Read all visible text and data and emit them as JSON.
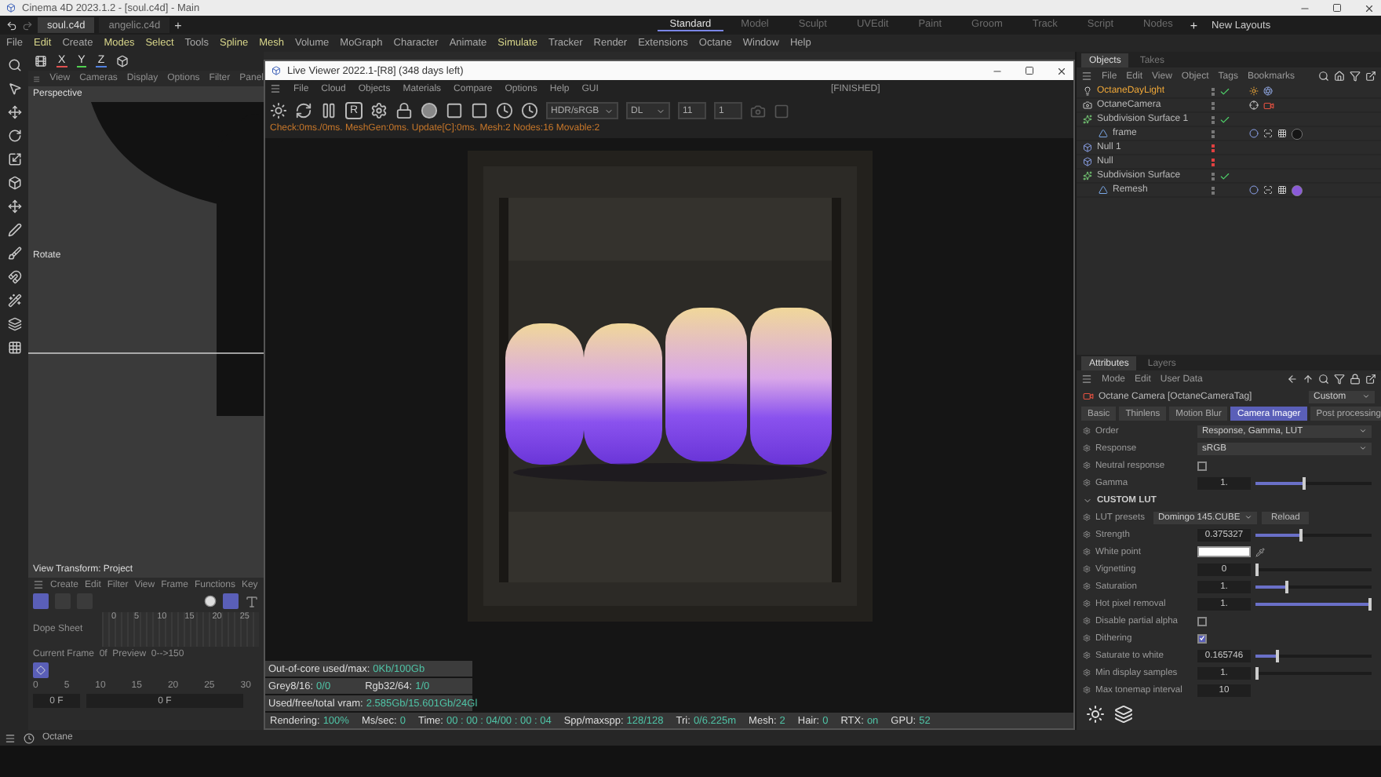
{
  "app_title": "Cinema 4D 2023.1.2 - [soul.c4d] - Main",
  "doc_tabs": [
    {
      "label": "soul.c4d",
      "selected": true
    },
    {
      "label": "angelic.c4d",
      "selected": false
    }
  ],
  "add_tab": "+",
  "layouts": [
    {
      "label": "Standard",
      "selected": true
    },
    {
      "label": "Model",
      "selected": false
    },
    {
      "label": "Sculpt",
      "selected": false
    },
    {
      "label": "UVEdit",
      "selected": false
    },
    {
      "label": "Paint",
      "selected": false
    },
    {
      "label": "Groom",
      "selected": false
    },
    {
      "label": "Track",
      "selected": false
    },
    {
      "label": "Script",
      "selected": false
    },
    {
      "label": "Nodes",
      "selected": false
    }
  ],
  "add_layout": "+",
  "new_layouts": "New Layouts",
  "menu": [
    {
      "label": "File",
      "highlight": false
    },
    {
      "label": "Edit",
      "highlight": true
    },
    {
      "label": "Create",
      "highlight": false
    },
    {
      "label": "Modes",
      "highlight": true
    },
    {
      "label": "Select",
      "highlight": true
    },
    {
      "label": "Tools",
      "highlight": false
    },
    {
      "label": "Spline",
      "highlight": true
    },
    {
      "label": "Mesh",
      "highlight": true
    },
    {
      "label": "Volume",
      "highlight": false
    },
    {
      "label": "MoGraph",
      "highlight": false
    },
    {
      "label": "Character",
      "highlight": false
    },
    {
      "label": "Animate",
      "highlight": false
    },
    {
      "label": "Simulate",
      "highlight": true
    },
    {
      "label": "Tracker",
      "highlight": false
    },
    {
      "label": "Render",
      "highlight": false
    },
    {
      "label": "Extensions",
      "highlight": false
    },
    {
      "label": "Octane",
      "highlight": false
    },
    {
      "label": "Window",
      "highlight": false
    },
    {
      "label": "Help",
      "highlight": false
    }
  ],
  "viewport": {
    "axes": [
      "X",
      "Y",
      "Z"
    ],
    "menu": [
      "View",
      "Cameras",
      "Display",
      "Options",
      "Filter",
      "Panel"
    ],
    "camera": "Perspective",
    "tool": "Rotate",
    "transform": "View Transform: Project"
  },
  "timeline": {
    "menu": [
      "Create",
      "Edit",
      "Filter",
      "View",
      "Frame",
      "Functions",
      "Key"
    ],
    "mode": "Dope Sheet",
    "ruler": [
      "0",
      "5",
      "10",
      "15",
      "20",
      "25"
    ],
    "current": "Current Frame  0f  Preview  0-->150",
    "ruler2": [
      "0",
      "5",
      "10",
      "15",
      "20",
      "25",
      "30"
    ],
    "start": "0 F",
    "end": "0 F"
  },
  "live_viewer": {
    "title": "Live Viewer 2022.1-[R8] (348 days left)",
    "menu": [
      "File",
      "Cloud",
      "Objects",
      "Materials",
      "Compare",
      "Options",
      "Help",
      "GUI"
    ],
    "state": "[FINISHED]",
    "r_button": "R",
    "tonemap": "HDR/sRGB",
    "kernel": "DL",
    "fields": [
      "11",
      "1"
    ],
    "log": "Check:0ms./0ms. MeshGen:0ms. Update[C]:0ms. Mesh:2 Nodes:16 Movable:2",
    "render": {
      "kind": "picture"
    },
    "stats": [
      {
        "items": [
          {
            "label": "Out-of-core used/max:",
            "value": "0Kb/100Gb"
          }
        ]
      },
      {
        "items": [
          {
            "label": "Grey8/16:",
            "value": "0/0"
          },
          {
            "label": "Rgb32/64:",
            "value": "1/0"
          }
        ]
      },
      {
        "items": [
          {
            "label": "Used/free/total vram:",
            "value": "2.585Gb/15.601Gb/24Gl"
          }
        ]
      }
    ],
    "status": [
      {
        "label": "Rendering:",
        "value": "100%"
      },
      {
        "label": "Ms/sec:",
        "value": "0"
      },
      {
        "label": "Time:",
        "value": "00 : 00 : 04/00 : 00 : 04"
      },
      {
        "label": "Spp/maxspp:",
        "value": "128/128"
      },
      {
        "label": "Tri:",
        "value": "0/6.225m"
      },
      {
        "label": "Mesh:",
        "value": "2"
      },
      {
        "label": "Hair:",
        "value": "0"
      },
      {
        "label": "RTX:",
        "value": "on"
      },
      {
        "label": "GPU:",
        "value": "52"
      }
    ]
  },
  "objects_panel": {
    "tabs": [
      {
        "label": "Objects",
        "selected": true
      },
      {
        "label": "Takes",
        "selected": false
      }
    ],
    "menu": [
      "File",
      "Edit",
      "View",
      "Object",
      "Tags",
      "Bookmarks"
    ],
    "objects": [
      {
        "name": "OctaneDayLight",
        "kind": "light",
        "selected": true,
        "enabled": true,
        "hidden": false,
        "tags": [
          {
            "kind": "sun"
          },
          {
            "kind": "sky"
          }
        ]
      },
      {
        "name": "OctaneCamera",
        "kind": "camera",
        "selected": false,
        "enabled": false,
        "hidden": false,
        "tags": [
          {
            "kind": "target"
          },
          {
            "kind": "camera"
          }
        ]
      },
      {
        "name": "Subdivision Surface 1",
        "kind": "subdivision",
        "selected": false,
        "enabled": true,
        "hidden": false,
        "children": [
          {
            "name": "frame",
            "kind": "mesh",
            "selected": false,
            "enabled": false,
            "hidden": false,
            "tags": [
              {
                "kind": "phong"
              },
              {
                "kind": "uv"
              },
              {
                "kind": "checker"
              },
              {
                "kind": "material",
                "color": "#151515"
              }
            ]
          }
        ]
      },
      {
        "name": "Null 1",
        "kind": "null",
        "selected": false,
        "enabled": false,
        "hidden": true
      },
      {
        "name": "Null",
        "kind": "null",
        "selected": false,
        "enabled": false,
        "hidden": true
      },
      {
        "name": "Subdivision Surface",
        "kind": "subdivision",
        "selected": false,
        "enabled": true,
        "hidden": false,
        "children": [
          {
            "name": "Remesh",
            "kind": "mesh",
            "selected": false,
            "enabled": false,
            "hidden": false,
            "tags": [
              {
                "kind": "phong"
              },
              {
                "kind": "uv"
              },
              {
                "kind": "checker"
              },
              {
                "kind": "material",
                "color": "#8a5ad8"
              }
            ]
          }
        ]
      }
    ]
  },
  "attributes": {
    "tabs": [
      {
        "label": "Attributes",
        "selected": true
      },
      {
        "label": "Layers",
        "selected": false
      }
    ],
    "menu": [
      "Mode",
      "Edit",
      "User Data"
    ],
    "object": "Octane Camera [OctaneCameraTag]",
    "preset": "Custom",
    "subtabs": [
      {
        "label": "Basic",
        "selected": false
      },
      {
        "label": "Thinlens",
        "selected": false
      },
      {
        "label": "Motion Blur",
        "selected": false
      },
      {
        "label": "Camera Imager",
        "selected": true
      },
      {
        "label": "Post processing",
        "selected": false
      }
    ],
    "properties": [
      {
        "kind": "dropdown",
        "label": "Order",
        "value": "Response, Gamma, LUT"
      },
      {
        "kind": "dropdown",
        "label": "Response",
        "value": "sRGB"
      },
      {
        "kind": "checkbox",
        "label": "Neutral response",
        "checked": false
      },
      {
        "kind": "slider",
        "label": "Gamma",
        "value": "1.",
        "level": 0.41
      },
      {
        "kind": "section",
        "label": "CUSTOM LUT",
        "expanded": true
      },
      {
        "kind": "preset",
        "label": "LUT presets",
        "value": "Domingo 145.CUBE",
        "button": "Reload"
      },
      {
        "kind": "slider",
        "label": "Strength",
        "value": "0.375327",
        "level": 0.375
      },
      {
        "kind": "color",
        "label": "White point",
        "color": "#ffffff"
      },
      {
        "kind": "slider",
        "label": "Vignetting",
        "value": "0",
        "level": 0
      },
      {
        "kind": "slider",
        "label": "Saturation",
        "value": "1.",
        "level": 0.25
      },
      {
        "kind": "slider",
        "label": "Hot pixel removal",
        "value": "1.",
        "level": 1
      },
      {
        "kind": "checkbox",
        "label": "Disable partial alpha",
        "checked": false
      },
      {
        "kind": "checkbox",
        "label": "Dithering",
        "checked": true
      },
      {
        "kind": "slider",
        "label": "Saturate to white",
        "value": "0.165746",
        "level": 0.17
      },
      {
        "kind": "slider",
        "label": "Min display samples",
        "value": "1.",
        "level": 0
      },
      {
        "kind": "number",
        "label": "Max tonemap interval",
        "value": "10"
      }
    ]
  },
  "status_bar": "Octane"
}
